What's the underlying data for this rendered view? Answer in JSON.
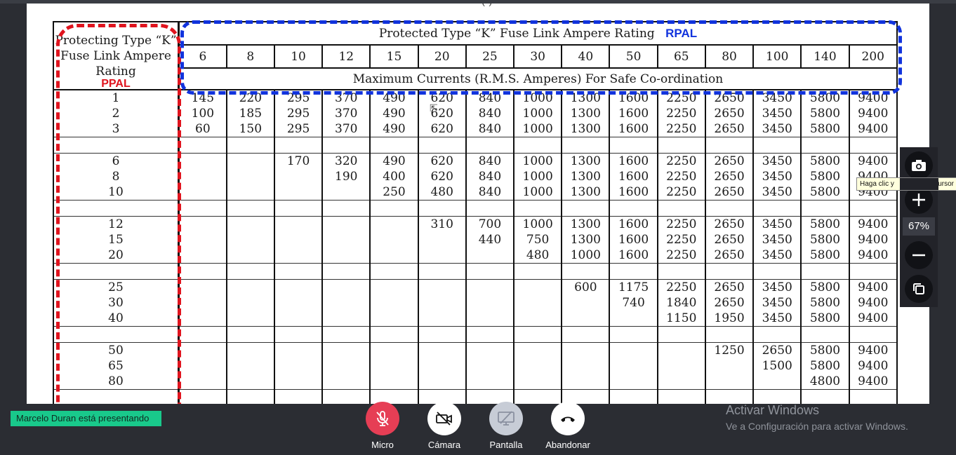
{
  "document": {
    "top_fragment": "(        )",
    "table": {
      "left_header": "Protecting Type “K” Fuse Link Ampere Rating",
      "left_tag": "PPAL",
      "top_header": "Protected Type “K” Fuse Link Ampere Rating",
      "top_tag": "RPAL",
      "subheader": "Maximum Currents (R.M.S. Amperes) For Safe Co-ordination",
      "columns": [
        "6",
        "8",
        "10",
        "12",
        "15",
        "20",
        "25",
        "30",
        "40",
        "50",
        "65",
        "80",
        "100",
        "140",
        "200"
      ],
      "rows": [
        {
          "rating": "1",
          "values": [
            "145",
            "220",
            "295",
            "370",
            "490",
            "620",
            "840",
            "1000",
            "1300",
            "1600",
            "2250",
            "2650",
            "3450",
            "5800",
            "9400"
          ]
        },
        {
          "rating": "2",
          "values": [
            "100",
            "185",
            "295",
            "370",
            "490",
            "620",
            "840",
            "1000",
            "1300",
            "1600",
            "2250",
            "2650",
            "3450",
            "5800",
            "9400"
          ]
        },
        {
          "rating": "3",
          "values": [
            "60",
            "150",
            "295",
            "370",
            "490",
            "620",
            "840",
            "1000",
            "1300",
            "1600",
            "2250",
            "2650",
            "3450",
            "5800",
            "9400"
          ]
        },
        {
          "rating": "",
          "values": [
            "",
            "",
            "",
            "",
            "",
            "",
            "",
            "",
            "",
            "",
            "",
            "",
            "",
            "",
            ""
          ]
        },
        {
          "rating": "6",
          "values": [
            "",
            "",
            "170",
            "320",
            "490",
            "620",
            "840",
            "1000",
            "1300",
            "1600",
            "2250",
            "2650",
            "3450",
            "5800",
            "9400"
          ]
        },
        {
          "rating": "8",
          "values": [
            "",
            "",
            "",
            "190",
            "400",
            "620",
            "840",
            "1000",
            "1300",
            "1600",
            "2250",
            "2650",
            "3450",
            "5800",
            "9400"
          ]
        },
        {
          "rating": "10",
          "values": [
            "",
            "",
            "",
            "",
            "250",
            "480",
            "840",
            "1000",
            "1300",
            "1600",
            "2250",
            "2650",
            "3450",
            "5800",
            "9400"
          ]
        },
        {
          "rating": "",
          "values": [
            "",
            "",
            "",
            "",
            "",
            "",
            "",
            "",
            "",
            "",
            "",
            "",
            "",
            "",
            ""
          ]
        },
        {
          "rating": "12",
          "values": [
            "",
            "",
            "",
            "",
            "",
            "310",
            "700",
            "1000",
            "1300",
            "1600",
            "2250",
            "2650",
            "3450",
            "5800",
            "9400"
          ]
        },
        {
          "rating": "15",
          "values": [
            "",
            "",
            "",
            "",
            "",
            "",
            "440",
            "750",
            "1300",
            "1600",
            "2250",
            "2650",
            "3450",
            "5800",
            "9400"
          ]
        },
        {
          "rating": "20",
          "values": [
            "",
            "",
            "",
            "",
            "",
            "",
            "",
            "480",
            "1000",
            "1600",
            "2250",
            "2650",
            "3450",
            "5800",
            "9400"
          ]
        },
        {
          "rating": "",
          "values": [
            "",
            "",
            "",
            "",
            "",
            "",
            "",
            "",
            "",
            "",
            "",
            "",
            "",
            "",
            ""
          ]
        },
        {
          "rating": "25",
          "values": [
            "",
            "",
            "",
            "",
            "",
            "",
            "",
            "",
            "600",
            "1175",
            "2250",
            "2650",
            "3450",
            "5800",
            "9400"
          ]
        },
        {
          "rating": "30",
          "values": [
            "",
            "",
            "",
            "",
            "",
            "",
            "",
            "",
            "",
            "740",
            "1840",
            "2650",
            "3450",
            "5800",
            "9400"
          ]
        },
        {
          "rating": "40",
          "values": [
            "",
            "",
            "",
            "",
            "",
            "",
            "",
            "",
            "",
            "",
            "1150",
            "1950",
            "3450",
            "5800",
            "9400"
          ]
        },
        {
          "rating": "",
          "values": [
            "",
            "",
            "",
            "",
            "",
            "",
            "",
            "",
            "",
            "",
            "",
            "",
            "",
            "",
            ""
          ]
        },
        {
          "rating": "50",
          "values": [
            "",
            "",
            "",
            "",
            "",
            "",
            "",
            "",
            "",
            "",
            "",
            "1250",
            "2650",
            "5800",
            "9400"
          ]
        },
        {
          "rating": "65",
          "values": [
            "",
            "",
            "",
            "",
            "",
            "",
            "",
            "",
            "",
            "",
            "",
            "",
            "1500",
            "5800",
            "9400"
          ]
        },
        {
          "rating": "80",
          "values": [
            "",
            "",
            "",
            "",
            "",
            "",
            "",
            "",
            "",
            "",
            "",
            "",
            "",
            "4800",
            "9400"
          ]
        },
        {
          "rating": "",
          "values": [
            "",
            "",
            "",
            "",
            "",
            "",
            "",
            "",
            "",
            "",
            "",
            "",
            "",
            "",
            ""
          ]
        }
      ]
    }
  },
  "viewer": {
    "zoom": "67%",
    "tooltip_left": "Haga clic y",
    "tooltip_right": "ursor",
    "buttons": [
      "camera-icon",
      "plus-icon",
      "minus-icon",
      "copy-icon"
    ]
  },
  "meeting": {
    "presenter": "Marcelo Duran está presentando",
    "controls": [
      {
        "label": "Micro",
        "icon": "mic-off-icon",
        "color": "#e63e55"
      },
      {
        "label": "Cámara",
        "icon": "camera-off-icon",
        "color": "#ffffff"
      },
      {
        "label": "Pantalla",
        "icon": "screen-share-off-icon",
        "color": "#c7ccd6"
      },
      {
        "label": "Abandonar",
        "icon": "phone-hangup-icon",
        "color": "#ffffff"
      }
    ]
  },
  "watermark": {
    "line1": "Activar Windows",
    "line2": "Ve a Configuración para activar Windows."
  }
}
